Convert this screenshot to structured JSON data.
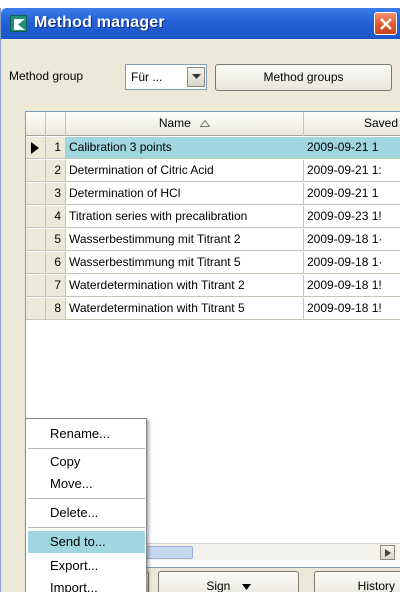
{
  "window": {
    "title": "Method manager",
    "icon": "app-logo-icon",
    "close_icon": "close-icon"
  },
  "toolbar": {
    "method_group_label": "Method group",
    "method_group_value": "Für ...",
    "method_groups_button": "Method groups"
  },
  "table": {
    "columns": [
      "Name",
      "Saved"
    ],
    "selected_row": 1,
    "rows": [
      {
        "num": "1",
        "name": "Calibration 3 points",
        "saved": "2009-09-21 1"
      },
      {
        "num": "2",
        "name": "Determination of Citric Acid",
        "saved": "2009-09-21 1:"
      },
      {
        "num": "3",
        "name": "Determination of HCl",
        "saved": "2009-09-21 1"
      },
      {
        "num": "4",
        "name": "Titration series with precalibration",
        "saved": "2009-09-23 1!"
      },
      {
        "num": "5",
        "name": "Wasserbestimmung mit Titrant 2",
        "saved": "2009-09-18 1·"
      },
      {
        "num": "6",
        "name": "Wasserbestimmung mit Titrant 5",
        "saved": "2009-09-18 1·"
      },
      {
        "num": "7",
        "name": "Waterdetermination with Titrant 2",
        "saved": "2009-09-18 1!"
      },
      {
        "num": "8",
        "name": "Waterdetermination with Titrant 5",
        "saved": "2009-09-18 1!"
      }
    ]
  },
  "context_menu": {
    "items": [
      "Rename...",
      "Copy",
      "Move...",
      "Delete...",
      "Send to...",
      "Export...",
      "Import..."
    ],
    "highlighted": "Send to..."
  },
  "bottom_buttons": {
    "sign": "Sign",
    "history": "History"
  },
  "colors": {
    "titlebar": "#2563d9",
    "selection": "#9fd6df",
    "window_bg": "#ece9d8"
  }
}
